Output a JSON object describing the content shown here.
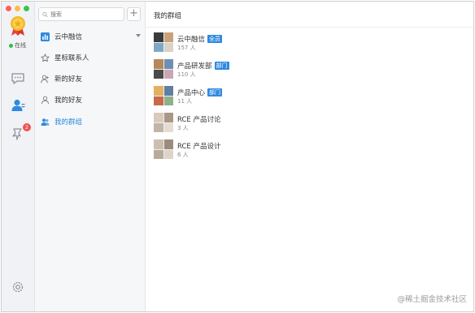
{
  "rail": {
    "status_label": "在线",
    "unread_badge": "2",
    "accent": "#2f8ae0"
  },
  "nav": {
    "search_placeholder": "搜索",
    "add_label": "+",
    "items": [
      {
        "label": "云中融信",
        "icon": "org-icon"
      },
      {
        "label": "星标联系人",
        "icon": "star-icon"
      },
      {
        "label": "新的好友",
        "icon": "person-add-icon"
      },
      {
        "label": "我的好友",
        "icon": "person-icon"
      },
      {
        "label": "我的群组",
        "icon": "group-icon"
      }
    ]
  },
  "main": {
    "title": "我的群组",
    "groups": [
      {
        "name": "云中融信",
        "tag": "全员",
        "count": "157 人"
      },
      {
        "name": "产品研发部",
        "tag": "部门",
        "count": "110 人"
      },
      {
        "name": "产品中心",
        "tag": "部门",
        "count": "11 人"
      },
      {
        "name": "RCE 产品讨论",
        "tag": "",
        "count": "3 人"
      },
      {
        "name": "RCE 产品设计",
        "tag": "",
        "count": "6 人"
      }
    ]
  },
  "watermark": "@稀土掘金技术社区"
}
